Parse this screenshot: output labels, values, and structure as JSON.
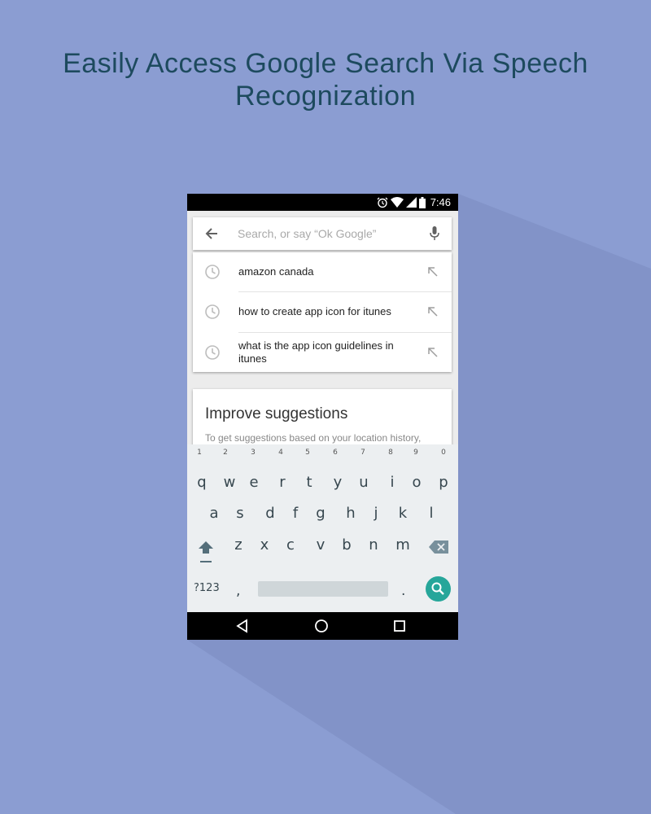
{
  "headline": {
    "line1": "Easily Access Google Search Via Speech",
    "line2": "Recognization"
  },
  "colors": {
    "background": "#8b9dd2",
    "headline": "#1d4a5e",
    "search_key": "#26a69a",
    "keyboard_bg": "#eceff1"
  },
  "status_bar": {
    "time": "7:46",
    "icons": [
      "alarm-icon",
      "wifi-icon",
      "signal-icon",
      "battery-icon"
    ]
  },
  "search": {
    "placeholder": "Search, or say “Ok Google”",
    "value": "",
    "back_icon": "arrow-back-icon",
    "mic_icon": "mic-icon"
  },
  "suggestions": [
    {
      "text": "amazon canada",
      "icon": "history-clock-icon",
      "action_icon": "insert-arrow-icon"
    },
    {
      "text": "how to create app icon for itunes",
      "icon": "history-clock-icon",
      "action_icon": "insert-arrow-icon"
    },
    {
      "text": "what is the app icon guidelines in itunes",
      "icon": "history-clock-icon",
      "action_icon": "insert-arrow-icon"
    }
  ],
  "improve_card": {
    "title": "Improve suggestions",
    "body": "To get suggestions based on your location history,"
  },
  "keyboard": {
    "number_hints": [
      "1",
      "2",
      "3",
      "4",
      "5",
      "6",
      "7",
      "8",
      "9",
      "0"
    ],
    "row1": [
      "q",
      "w",
      "e",
      "r",
      "t",
      "y",
      "u",
      "i",
      "o",
      "p"
    ],
    "row2": [
      "a",
      "s",
      "d",
      "f",
      "g",
      "h",
      "j",
      "k",
      "l"
    ],
    "row3": [
      "z",
      "x",
      "c",
      "v",
      "b",
      "n",
      "m"
    ],
    "symbols_label": "?123",
    "comma": ",",
    "period": ".",
    "shift_icon": "shift-icon",
    "backspace_icon": "backspace-icon",
    "search_icon": "search-icon"
  },
  "nav_bar": {
    "icons": [
      "back-triangle-icon",
      "home-circle-icon",
      "recents-square-icon"
    ]
  }
}
